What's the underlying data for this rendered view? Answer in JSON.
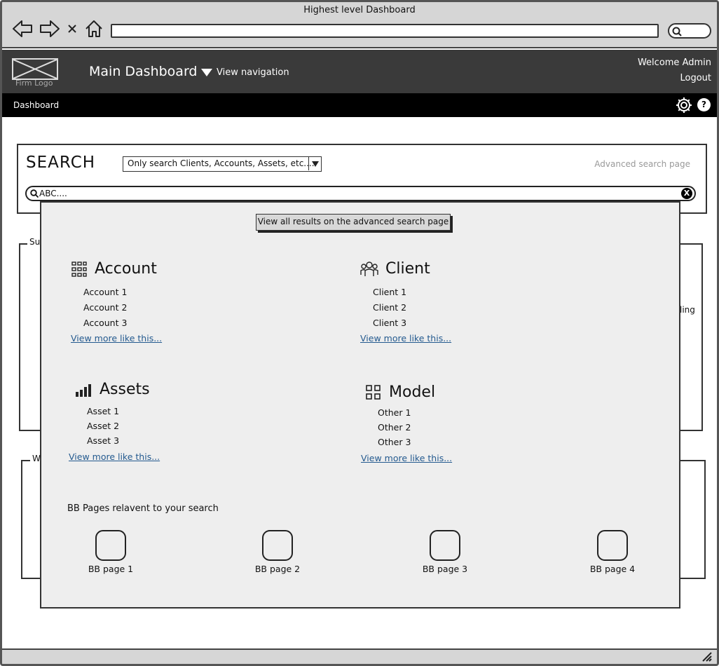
{
  "window": {
    "title": "Highest level Dashboard"
  },
  "header": {
    "logo_text": "Firm Logo",
    "title": "Main Dashboard",
    "nav_label": "View navigation",
    "welcome": "Welcome Admin",
    "logout": "Logout"
  },
  "breadcrumb": {
    "label": "Dashboard",
    "help": "?"
  },
  "background": {
    "panel1_label": "Su",
    "panel1_right_text": "ling",
    "panel2_label": "W"
  },
  "search": {
    "title": "SEARCH",
    "scope_selected": "Only search Clients, Accounts, Assets, etc....",
    "advanced_link": "Advanced search page",
    "query": "ABC....",
    "clear": "X"
  },
  "results": {
    "view_all_label": "View all results on the advanced search page",
    "sections": [
      {
        "icon": "grid-icon",
        "title": "Account",
        "items": [
          "Account 1",
          "Account 2",
          "Account 3"
        ],
        "more": "View more like this..."
      },
      {
        "icon": "group-icon",
        "title": "Client",
        "items": [
          "Client 1",
          "Client 2",
          "Client 3"
        ],
        "more": "View more like this..."
      },
      {
        "icon": "bar-chart-icon",
        "title": "Assets",
        "items": [
          "Asset 1",
          "Asset 2",
          "Asset 3"
        ],
        "more": "View more like this..."
      },
      {
        "icon": "tiles-icon",
        "title": "Model",
        "items": [
          "Other 1",
          "Other 2",
          "Other 3"
        ],
        "more": "View more like this..."
      }
    ],
    "bb_heading": "BB Pages relavent to your search",
    "bb_pages": [
      "BB page 1",
      "BB page 2",
      "BB page 3",
      "BB page 4"
    ]
  }
}
